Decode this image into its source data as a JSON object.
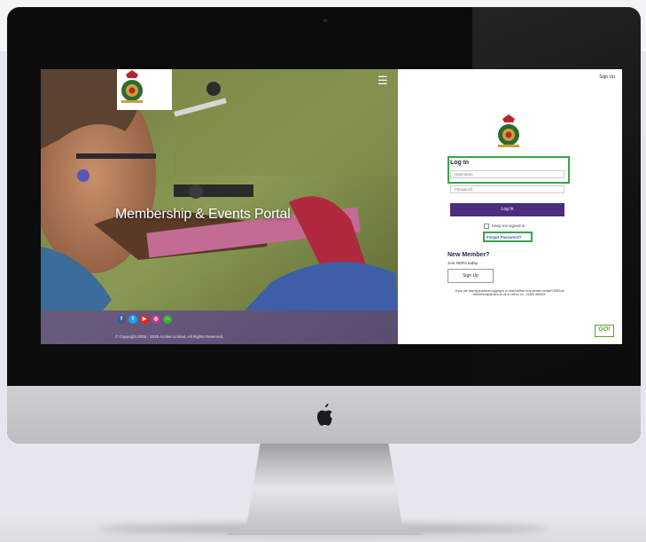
{
  "hero": {
    "title": "Membership & Events Portal",
    "copyright": "© Copyright 2003 - 2020 Azolve Limited. All Rights Reserved.",
    "menu_icon": "hamburger-menu-icon"
  },
  "socials": [
    {
      "icon": "facebook-icon",
      "glyph": "f",
      "color": "#3b5998"
    },
    {
      "icon": "twitter-icon",
      "glyph": "t",
      "color": "#1da1f2"
    },
    {
      "icon": "youtube-icon",
      "glyph": "▶",
      "color": "#e62117"
    },
    {
      "icon": "instagram-icon",
      "glyph": "◎",
      "color": "#c13584"
    },
    {
      "icon": "home-icon",
      "glyph": "⌂",
      "color": "#3fae3a"
    }
  ],
  "panel": {
    "signup_link": "Sign Up",
    "login_heading": "Log In",
    "username_placeholder": "Username",
    "password_placeholder": "Password",
    "login_button": "Log In",
    "keep_signed_in": "Keep me signed in",
    "forgot_password": "Forgot Password?",
    "new_member_heading": "New Member?",
    "join_text": "Join NSRA today",
    "signup_button": "Sign Up",
    "help_text": "If you are having problems logging in or need further help please contact NSRA at membership@nsra.co.uk or call us on - 01483 485002.",
    "go_logo": "GO!"
  },
  "colors": {
    "accent_purple": "#4b2d7f",
    "highlight_green": "#3aa34a"
  }
}
